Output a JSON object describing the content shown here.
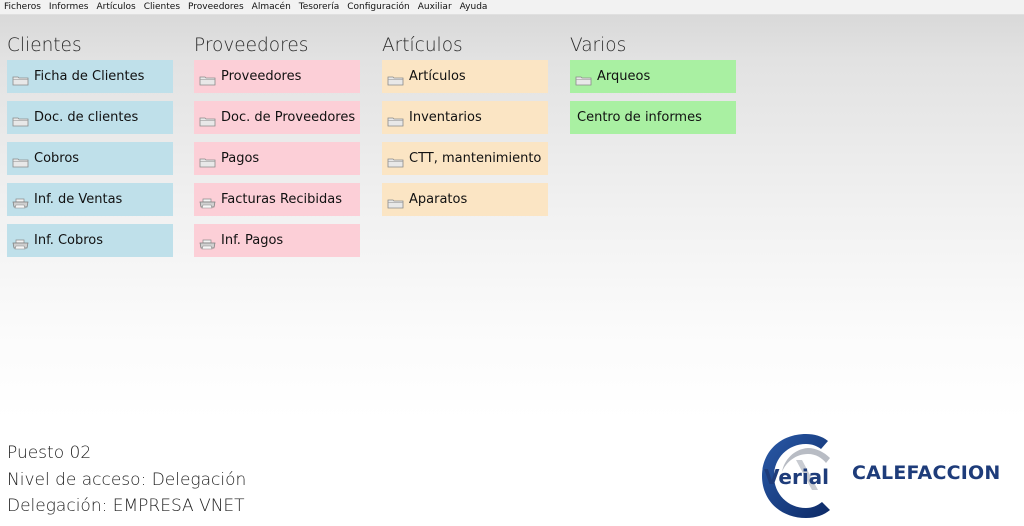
{
  "menubar": {
    "items": [
      "Ficheros",
      "Informes",
      "Artículos",
      "Clientes",
      "Proveedores",
      "Almacén",
      "Tesorería",
      "Configuración",
      "Auxiliar",
      "Ayuda"
    ]
  },
  "columns": {
    "clientes": {
      "title": "Clientes",
      "color": "#bfe0ea",
      "items": [
        {
          "label": "Ficha de Clientes",
          "icon": "folder-icon"
        },
        {
          "label": "Doc. de clientes",
          "icon": "folder-icon"
        },
        {
          "label": "Cobros",
          "icon": "folder-icon"
        },
        {
          "label": "Inf. de Ventas",
          "icon": "printer-icon"
        },
        {
          "label": "Inf. Cobros",
          "icon": "printer-icon"
        }
      ]
    },
    "proveedores": {
      "title": "Proveedores",
      "color": "#fccfd7",
      "items": [
        {
          "label": "Proveedores",
          "icon": "folder-icon"
        },
        {
          "label": "Doc. de Proveedores",
          "icon": "folder-icon"
        },
        {
          "label": "Pagos",
          "icon": "folder-icon"
        },
        {
          "label": "Facturas Recibidas",
          "icon": "printer-icon"
        },
        {
          "label": "Inf. Pagos",
          "icon": "printer-icon"
        }
      ]
    },
    "articulos": {
      "title": "Artículos",
      "color": "#fbe5c4",
      "items": [
        {
          "label": "Artículos",
          "icon": "folder-icon"
        },
        {
          "label": "Inventarios",
          "icon": "folder-icon"
        },
        {
          "label": "CTT, mantenimiento",
          "icon": "folder-icon"
        },
        {
          "label": "Aparatos",
          "icon": "folder-icon"
        }
      ]
    },
    "varios": {
      "title": "Varios",
      "color": "#a9f0a2",
      "items": [
        {
          "label": "Arqueos",
          "icon": "folder-icon"
        },
        {
          "label": "Centro de informes",
          "icon": ""
        }
      ]
    }
  },
  "status": {
    "puesto": "Puesto 02",
    "nivel": "Nivel de acceso: Delegación",
    "delegacion": "Delegación: EMPRESA VNET"
  },
  "brand": {
    "logo_text": "Verial",
    "name": "CALEFACCION",
    "color": "#1e3c7a"
  }
}
